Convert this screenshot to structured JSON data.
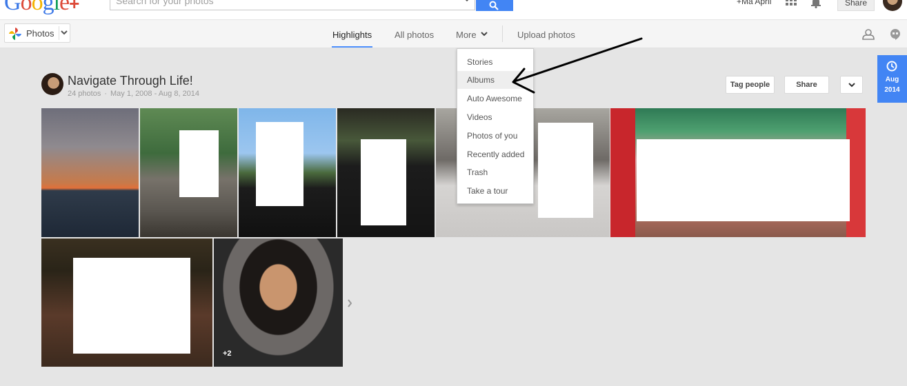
{
  "topbar": {
    "logo_text": "Google",
    "logo_plus": "+",
    "search_placeholder": "Search for your photos",
    "user_name": "+Ma April",
    "share_label": "Share"
  },
  "nav": {
    "photos_label": "Photos",
    "items": [
      "Highlights",
      "All photos",
      "More",
      "Upload photos"
    ],
    "active": "Highlights"
  },
  "album": {
    "title": "Navigate Through Life!",
    "photo_count": "24 photos",
    "separator": "·",
    "date_range": "May 1, 2008 - Aug 8, 2014",
    "tag_people_label": "Tag people",
    "share_label": "Share",
    "more_photos_badge": "+2"
  },
  "date_flag": {
    "month": "Aug",
    "year": "2014"
  },
  "more_menu": {
    "items": [
      "Stories",
      "Albums",
      "Auto Awesome",
      "Videos",
      "Photos of you",
      "Recently added",
      "Trash",
      "Take a tour"
    ],
    "highlighted": "Albums"
  },
  "colors": {
    "accent": "#4285f4",
    "nav_underline": "#4d90fe",
    "page_bg": "#e5e5e5"
  },
  "icons": [
    "search-icon",
    "apps-grid-icon",
    "notification-bell-icon",
    "pinwheel-icon",
    "chevron-down-icon",
    "clock-icon",
    "hangouts-icon",
    "cloud-user-icon",
    "chevron-right-icon"
  ]
}
